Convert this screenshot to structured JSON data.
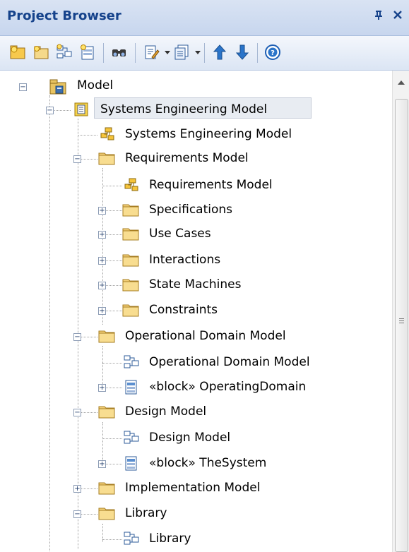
{
  "panel": {
    "title": "Project Browser",
    "pin_glyph": "⌘",
    "close_glyph": "✕"
  },
  "toolbar": {
    "buttons": [
      "new-package-icon",
      "new-view-icon",
      "new-diagram-icon",
      "new-element-icon",
      "find-icon",
      "edit-note-icon",
      "options-icon",
      "move-up-icon",
      "move-down-icon",
      "help-icon"
    ]
  },
  "tree": {
    "items": [
      {
        "label": "Model",
        "icon": "model-root-icon",
        "expander": "-"
      },
      {
        "label": "Systems Engineering Model",
        "icon": "package-view-icon",
        "expander": "-"
      },
      {
        "label": "Systems Engineering Model",
        "icon": "package-diagram-icon",
        "expander": ""
      },
      {
        "label": "Requirements Model",
        "icon": "folder-icon",
        "expander": "-"
      },
      {
        "label": "Requirements Model",
        "icon": "package-diagram-icon",
        "expander": ""
      },
      {
        "label": "Specifications",
        "icon": "folder-icon",
        "expander": "+"
      },
      {
        "label": "Use Cases",
        "icon": "folder-icon",
        "expander": "+"
      },
      {
        "label": "Interactions",
        "icon": "folder-icon",
        "expander": "+"
      },
      {
        "label": "State Machines",
        "icon": "folder-icon",
        "expander": "+"
      },
      {
        "label": "Constraints",
        "icon": "folder-icon",
        "expander": "+"
      },
      {
        "label": "Operational Domain Model",
        "icon": "folder-icon",
        "expander": "-"
      },
      {
        "label": "Operational Domain Model",
        "icon": "block-diagram-icon",
        "expander": ""
      },
      {
        "label": "«block» OperatingDomain",
        "icon": "block-element-icon",
        "expander": "+"
      },
      {
        "label": "Design Model",
        "icon": "folder-icon",
        "expander": "-"
      },
      {
        "label": "Design Model",
        "icon": "block-diagram-icon",
        "expander": ""
      },
      {
        "label": "«block» TheSystem",
        "icon": "block-element-icon",
        "expander": "+"
      },
      {
        "label": "Implementation Model",
        "icon": "folder-icon",
        "expander": "+"
      },
      {
        "label": "Library",
        "icon": "folder-icon",
        "expander": "-"
      },
      {
        "label": "Library",
        "icon": "block-diagram-icon",
        "expander": ""
      }
    ]
  }
}
